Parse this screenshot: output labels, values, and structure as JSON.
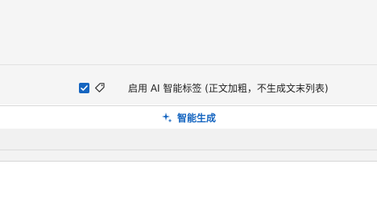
{
  "options": {
    "ai_tag": {
      "checked": true,
      "label": "启用 AI 智能标签 (正文加粗，不生成文末列表)"
    }
  },
  "actions": {
    "generate_label": "智能生成"
  },
  "icons": {
    "tag": "tag-icon",
    "sparkle": "sparkle-icon"
  },
  "colors": {
    "accent": "#1565c0",
    "background": "#f5f5f5",
    "surface": "#ffffff",
    "border": "#d8d8d8",
    "text": "#1f1f1f"
  }
}
